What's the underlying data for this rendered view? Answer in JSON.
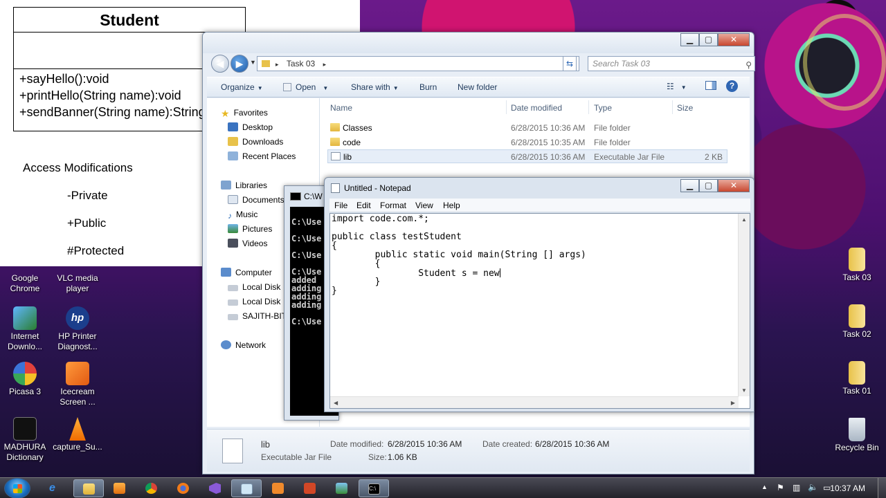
{
  "slide": {
    "uml_class_name": "Student",
    "uml_methods": [
      "+sayHello():void",
      "+printHello(String name):void",
      "+sendBanner(String name):String"
    ],
    "access_title": "Access Modifications",
    "access_items": [
      "-Private",
      "+Public",
      "#Protected"
    ]
  },
  "desktop_icons_left": [
    {
      "label": "Google\nChrome",
      "icon": "chrome-icon"
    },
    {
      "label": "VLC media\nplayer",
      "icon": "vlc-icon"
    },
    {
      "label": "Internet\nDownlo...",
      "icon": "idm-icon"
    },
    {
      "label": "HP Printer\nDiagnost...",
      "icon": "hp-icon"
    },
    {
      "label": "Picasa 3",
      "icon": "picasa-icon"
    },
    {
      "label": "Icecream\nScreen ...",
      "icon": "icecream-icon"
    },
    {
      "label": "MADHURA\nDictionary",
      "icon": "dictionary-icon"
    },
    {
      "label": "capture_Su...",
      "icon": "vlc-file-icon"
    }
  ],
  "desktop_icons_right": [
    {
      "label": "Task 03",
      "icon": "folder-icon"
    },
    {
      "label": "Task 02",
      "icon": "folder-icon"
    },
    {
      "label": "Task 01",
      "icon": "folder-icon"
    },
    {
      "label": "Recycle Bin",
      "icon": "recycle-bin-icon"
    }
  ],
  "explorer": {
    "breadcrumb_sep": "▸",
    "path": "Task 03",
    "search_placeholder": "Search Task 03",
    "toolbar": {
      "organize": "Organize",
      "open": "Open",
      "share_with": "Share with",
      "burn": "Burn",
      "new_folder": "New folder"
    },
    "nav": {
      "favorites": "Favorites",
      "desktop": "Desktop",
      "downloads": "Downloads",
      "recent_places": "Recent Places",
      "libraries": "Libraries",
      "documents": "Documents",
      "music": "Music",
      "pictures": "Pictures",
      "videos": "Videos",
      "computer": "Computer",
      "local_disk_c": "Local Disk",
      "local_disk_d": "Local Disk",
      "drive_e": "SAJITH-BIT",
      "network": "Network"
    },
    "columns": {
      "name": "Name",
      "date_modified": "Date modified",
      "type": "Type",
      "size": "Size"
    },
    "files": [
      {
        "name": "Classes",
        "date": "6/28/2015 10:36 AM",
        "type": "File folder",
        "size": "",
        "icon": "folder-icon"
      },
      {
        "name": "code",
        "date": "6/28/2015 10:35 AM",
        "type": "File folder",
        "size": "",
        "icon": "folder-icon"
      },
      {
        "name": "lib",
        "date": "6/28/2015 10:36 AM",
        "type": "Executable Jar File",
        "size": "2 KB",
        "icon": "jar-file-icon"
      }
    ],
    "status": {
      "name": "lib",
      "type": "Executable Jar File",
      "date_modified_label": "Date modified:",
      "date_modified": "6/28/2015 10:36 AM",
      "date_created_label": "Date created:",
      "date_created": "6/28/2015 10:36 AM",
      "size_label": "Size:",
      "size": "1.06 KB"
    }
  },
  "cmd": {
    "title": "C:\\W",
    "lines": [
      "",
      "C:\\Use",
      "",
      "C:\\Use",
      "",
      "C:\\Use",
      "",
      "C:\\Use",
      "added",
      "adding",
      "adding",
      "adding",
      "",
      "C:\\Use"
    ]
  },
  "notepad": {
    "title": "Untitled - Notepad",
    "menu": [
      "File",
      "Edit",
      "Format",
      "View",
      "Help"
    ],
    "code_lines": [
      "import code.com.*;",
      "",
      "public class testStudent",
      "{",
      "        public static void main(String [] args)",
      "        {",
      "                Student s = new",
      "        }",
      "}"
    ]
  },
  "taskbar": {
    "clock": "10:37 AM",
    "apps": [
      "ie-icon",
      "explorer-icon",
      "media-player-icon",
      "chrome-icon",
      "firefox-icon",
      "visual-studio-icon",
      "notepad-icon",
      "icecream-icon",
      "ppt-icon",
      "photo-viewer-icon",
      "cmd-icon"
    ]
  }
}
